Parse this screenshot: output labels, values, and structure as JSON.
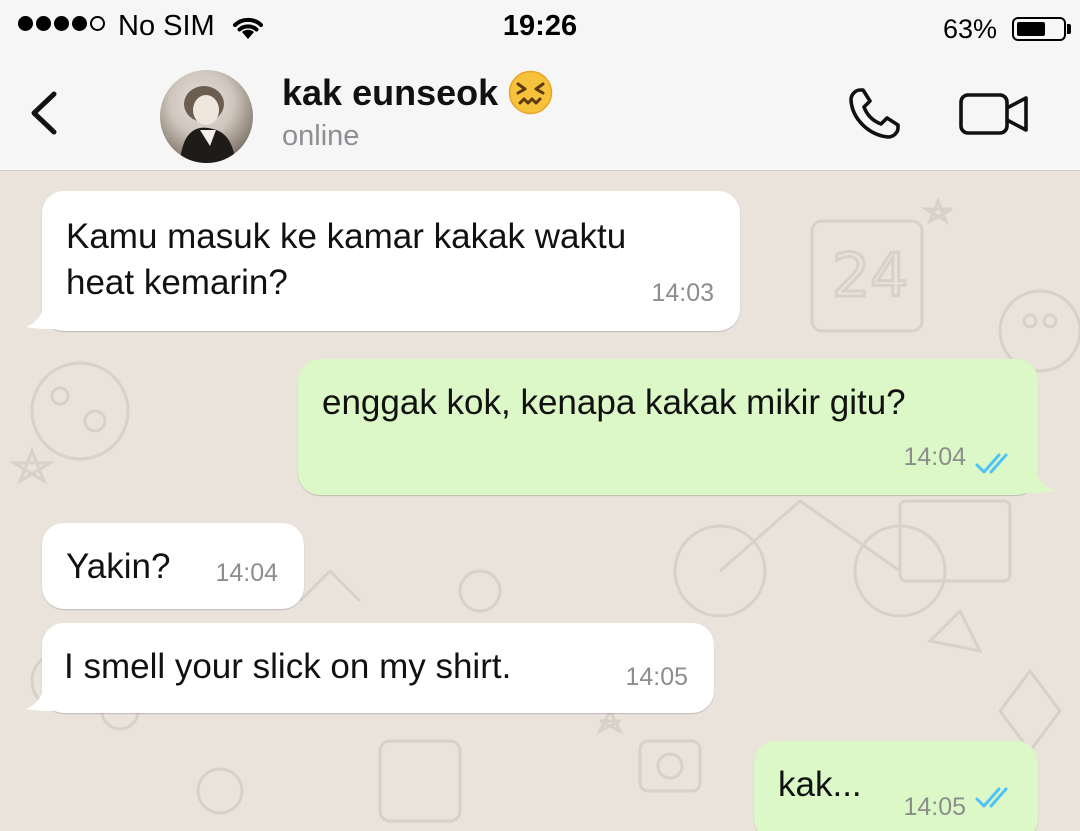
{
  "status_bar": {
    "carrier": "No SIM",
    "time": "19:26",
    "battery_percent": "63%",
    "battery_level": 0.63,
    "signal_bars_filled": 4,
    "signal_bars_total": 5
  },
  "header": {
    "contact_name": "kak eunseok",
    "contact_emoji": "confounded-face",
    "contact_status": "online",
    "icons": {
      "back": "chevron-left-icon",
      "call": "phone-icon",
      "video": "video-camera-icon"
    }
  },
  "messages": [
    {
      "direction": "incoming",
      "lines": [
        "Kamu masuk ke kamar kakak waktu",
        "heat kemarin?"
      ],
      "time": "14:03"
    },
    {
      "direction": "outgoing",
      "text": "enggak kok, kenapa kakak mikir gitu?",
      "time": "14:04",
      "read": true
    },
    {
      "direction": "incoming",
      "text": "Yakin?",
      "time": "14:04"
    },
    {
      "direction": "incoming",
      "text": "I smell your slick on my shirt.",
      "time": "14:05"
    },
    {
      "direction": "outgoing",
      "text": "kak...",
      "time": "14:05",
      "read": true
    }
  ],
  "colors": {
    "incoming_bubble": "#ffffff",
    "outgoing_bubble": "#dcf8c6",
    "chat_background": "#e9e3dc",
    "read_ticks": "#4fc3f7",
    "header_background": "#f6f6f6"
  }
}
